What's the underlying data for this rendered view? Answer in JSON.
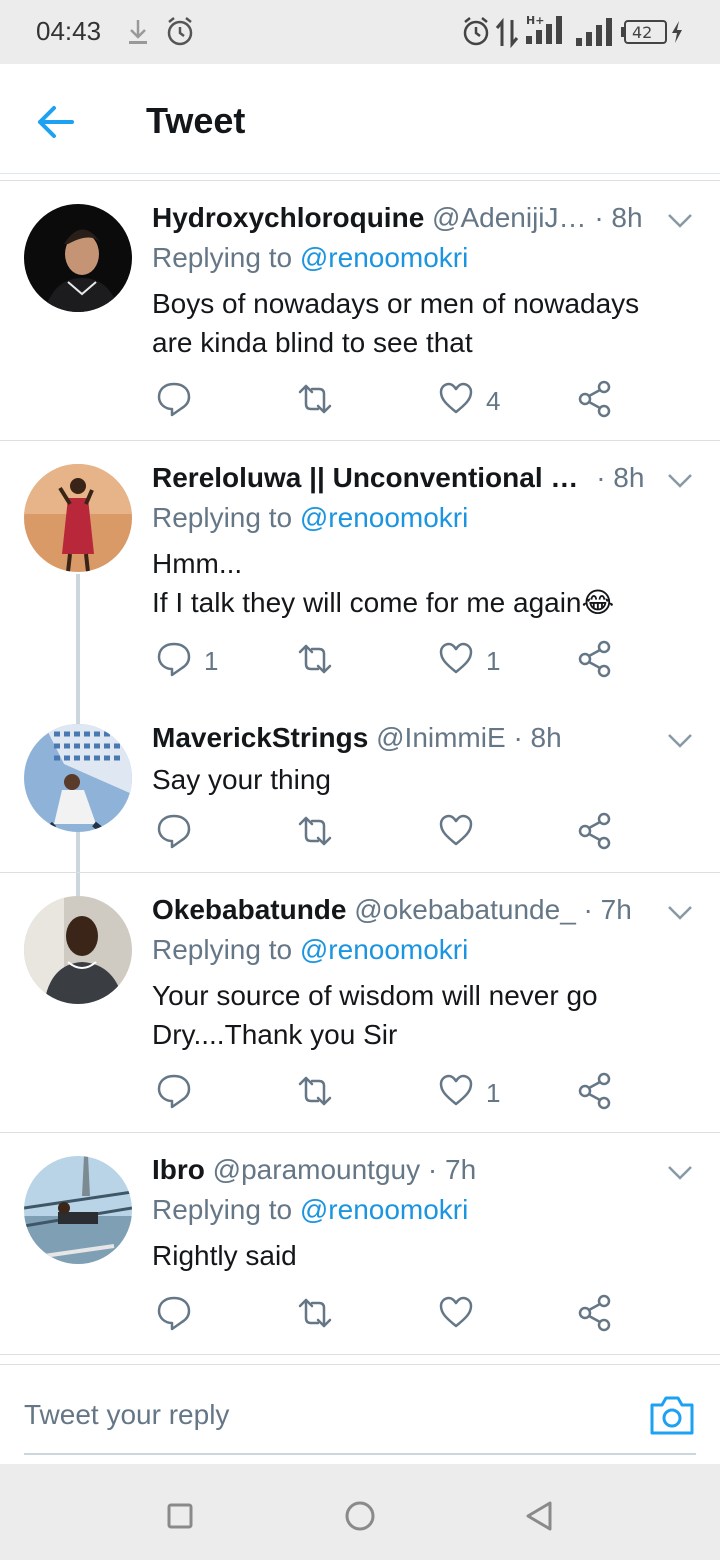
{
  "status_bar": {
    "time": "04:43",
    "battery": "42",
    "icons": [
      "download-icon",
      "alarm-icon",
      "alarm-icon",
      "data-transfer-icon",
      "signal-hplus-icon",
      "signal-icon",
      "battery-icon",
      "charging-icon"
    ]
  },
  "header": {
    "title": "Tweet",
    "back_icon": "arrow-left-icon"
  },
  "tweets": [
    {
      "name": "Hydroxychloroquine",
      "handle": "@AdenijiJ…",
      "time": "· 8h",
      "replying_prefix": "Replying to ",
      "replying_to": "@renoomokri",
      "text_lines": [
        "Boys of nowadays or men of nowadays",
        "are kinda blind to see that"
      ],
      "replies": "",
      "retweets": "",
      "likes": "4"
    },
    {
      "name": "Rereloluwa || Unconventional …",
      "handle": "",
      "time": "· 8h",
      "replying_prefix": "Replying to ",
      "replying_to": "@renoomokri",
      "text_lines": [
        "Hmm...",
        "If I talk they will come for me again😂"
      ],
      "replies": "1",
      "retweets": "",
      "likes": "1"
    },
    {
      "name": "MaverickStrings",
      "handle": "@InimmiE",
      "time": "· 8h",
      "replying_prefix": "",
      "replying_to": "",
      "text_lines": [
        "Say your thing"
      ],
      "replies": "",
      "retweets": "",
      "likes": ""
    },
    {
      "name": "Okebabatunde",
      "handle": "@okebabatunde_",
      "time": "· 7h",
      "replying_prefix": "Replying to ",
      "replying_to": "@renoomokri",
      "text_lines": [
        "Your source of wisdom will never go",
        "Dry....Thank you Sir"
      ],
      "replies": "",
      "retweets": "",
      "likes": "1"
    },
    {
      "name": "Ibro",
      "handle": "@paramountguy",
      "time": "· 7h",
      "replying_prefix": "Replying to ",
      "replying_to": "@renoomokri",
      "text_lines": [
        "Rightly said"
      ],
      "replies": "",
      "retweets": "",
      "likes": ""
    }
  ],
  "reply_bar": {
    "placeholder": "Tweet your reply",
    "camera_icon": "camera-icon"
  },
  "nav_bar": {
    "icons": [
      "recent-apps-icon",
      "home-icon",
      "back-icon"
    ]
  },
  "colors": {
    "accent": "#1da1f2",
    "mention": "#1b95e0",
    "secondary_text": "#657786",
    "divider": "#dadfe3",
    "system_bar": "#ececec"
  }
}
